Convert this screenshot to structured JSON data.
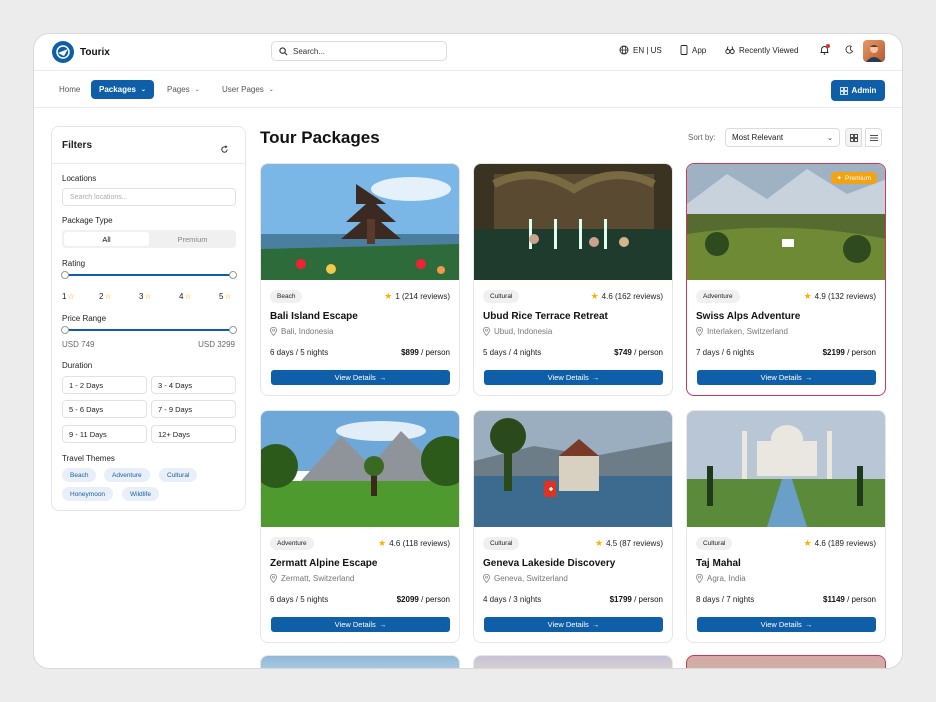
{
  "app": {
    "name": "Tourix"
  },
  "search": {
    "placeholder": "Search..."
  },
  "topbar": {
    "lang": "EN | US",
    "app": "App",
    "recent": "Recently Viewed"
  },
  "nav": {
    "home": "Home",
    "packages": "Packages",
    "pages": "Pages",
    "user_pages": "User Pages",
    "admin": "Admin"
  },
  "filters": {
    "title": "Filters",
    "locations_label": "Locations",
    "locations_placeholder": "Search locations...",
    "package_type_label": "Package Type",
    "package_types": [
      "All",
      "Premium"
    ],
    "rating_label": "Rating",
    "ratings": [
      "1",
      "2",
      "3",
      "4",
      "5"
    ],
    "price_label": "Price Range",
    "price_min": "USD 749",
    "price_max": "USD 3299",
    "duration_label": "Duration",
    "durations": [
      "1 - 2 Days",
      "3 - 4 Days",
      "5 - 6 Days",
      "7 - 9 Days",
      "9 - 11 Days",
      "12+ Days"
    ],
    "themes_label": "Travel Themes",
    "themes": [
      "Beach",
      "Adventure",
      "Cultural",
      "Honeymoon",
      "Wildlife"
    ]
  },
  "main": {
    "title": "Tour Packages",
    "sort_label": "Sort by:",
    "sort_value": "Most Relevant"
  },
  "cards": [
    {
      "tag": "Beach",
      "rating": "1 (214 reviews)",
      "name": "Bali Island Escape",
      "location": "Bali, Indonesia",
      "duration": "6 days / 5 nights",
      "price": "$899",
      "per": " / person",
      "button": "View Details",
      "premium": false
    },
    {
      "tag": "Cultural",
      "rating": "4.6 (162 reviews)",
      "name": "Ubud Rice Terrace Retreat",
      "location": "Ubud, Indonesia",
      "duration": "5 days / 4 nights",
      "price": "$749",
      "per": " / person",
      "button": "View Details",
      "premium": false
    },
    {
      "tag": "Adventure",
      "rating": "4.9 (132 reviews)",
      "name": "Swiss Alps Adventure",
      "location": "Interlaken, Switzerland",
      "duration": "7 days / 6 nights",
      "price": "$2199",
      "per": " / person",
      "button": "View Details",
      "premium": true,
      "premium_label": "Premium"
    },
    {
      "tag": "Adventure",
      "rating": "4.6 (118 reviews)",
      "name": "Zermatt Alpine Escape",
      "location": "Zermatt, Switzerland",
      "duration": "6 days / 5 nights",
      "price": "$2099",
      "per": " / person",
      "button": "View Details",
      "premium": false
    },
    {
      "tag": "Cultural",
      "rating": "4.5 (87 reviews)",
      "name": "Geneva Lakeside Discovery",
      "location": "Geneva, Switzerland",
      "duration": "4 days / 3 nights",
      "price": "$1799",
      "per": " / person",
      "button": "View Details",
      "premium": false
    },
    {
      "tag": "Cultural",
      "rating": "4.6 (189 reviews)",
      "name": "Taj Mahal",
      "location": "Agra, India",
      "duration": "8 days / 7 nights",
      "price": "$1149",
      "per": " / person",
      "button": "View Details",
      "premium": false
    }
  ],
  "colors": {
    "accent": "#0f5fa8",
    "premium": "#f1a314",
    "star": "#f5b301"
  }
}
